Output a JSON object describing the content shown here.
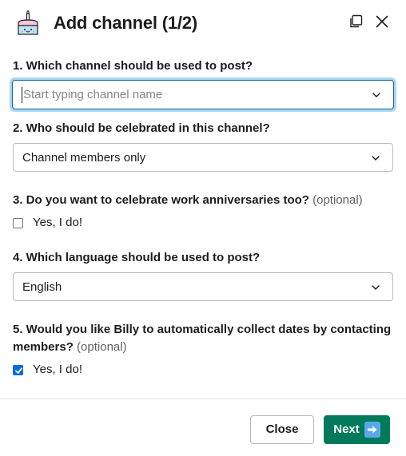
{
  "header": {
    "title": "Add channel (1/2)",
    "app_icon": "birthday-cake-icon",
    "popout_icon": "popout-icon",
    "close_icon": "close-icon"
  },
  "questions": {
    "q1": {
      "label": "1. Which channel should be used to post?",
      "placeholder": "Start typing channel name",
      "value": ""
    },
    "q2": {
      "label": "2. Who should be celebrated in this channel?",
      "value": "Channel members only"
    },
    "q3": {
      "label": "3. Do you want to celebrate work anniversaries too?",
      "optional": "(optional)",
      "checkbox_label": "Yes, I do!",
      "checked": false
    },
    "q4": {
      "label": "4. Which language should be used to post?",
      "value": "English"
    },
    "q5": {
      "label_line1": "5. Would you like Billy to automatically collect dates by contacting",
      "label_line2": "members?",
      "optional": "(optional)",
      "checkbox_label": "Yes, I do!",
      "checked": true
    }
  },
  "footer": {
    "close_label": "Close",
    "next_label": "Next",
    "next_icon": "right-arrow-icon"
  },
  "colors": {
    "primary_button": "#007a5a",
    "focus_ring": "#a9d7f0",
    "focus_border": "#1264a3",
    "checkbox_checked": "#0b6bde"
  }
}
